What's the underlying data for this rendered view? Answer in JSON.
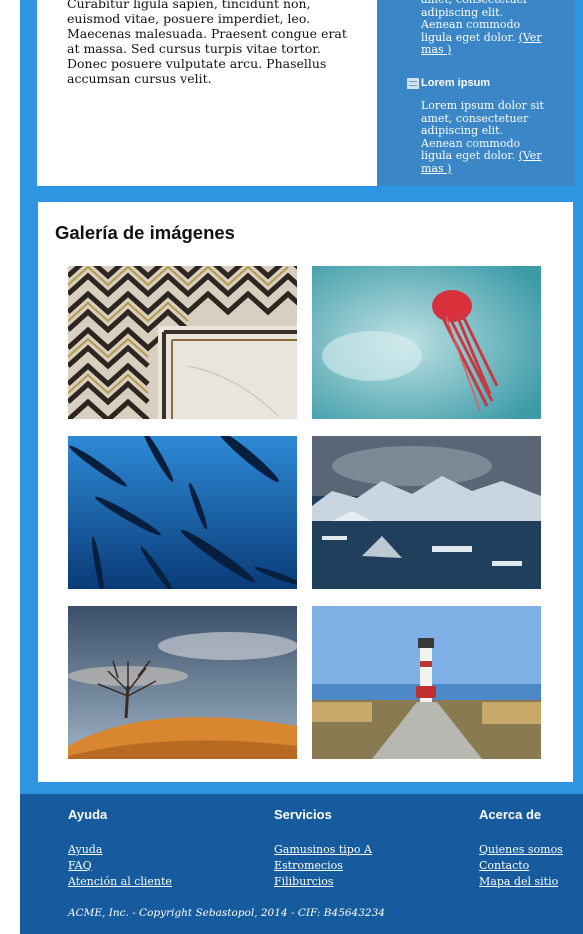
{
  "main": {
    "paragraph_tail": "Curabitur ligula sapien, tincidunt non, euismod vitae, posuere imperdiet, leo. Maecenas malesuada. Praesent congue erat at massa. Sed cursus turpis vitae tortor. Donec posuere vulputate arcu. Phasellus accumsan cursus velit."
  },
  "aside": {
    "item1_text": "amet, consectetuer adipiscing elit. Aenean commodo ligula eget dolor.",
    "item1_link": "(Ver mas )",
    "item2_title": "Lorem ipsum",
    "item2_text": "Lorem ipsum dolor sit amet, consectetuer adipiscing elit. Aenean commodo ligula eget dolor.",
    "item2_link": "(Ver mas )"
  },
  "gallery": {
    "title": "Galería de imágenes",
    "images": [
      {
        "name": "marble-inlay-image"
      },
      {
        "name": "jellyfish-image"
      },
      {
        "name": "fish-school-image"
      },
      {
        "name": "icebergs-image"
      },
      {
        "name": "lone-tree-image"
      },
      {
        "name": "lighthouse-road-image"
      }
    ]
  },
  "footer": {
    "columns": [
      {
        "title": "Ayuda",
        "links": [
          "Ayuda",
          "FAQ",
          "Atención al cliente"
        ]
      },
      {
        "title": "Servicios",
        "links": [
          "Gamusinos tipo A",
          "Estromecios",
          "Filiburcios"
        ]
      },
      {
        "title": "Acerca de",
        "links": [
          "Quienes somos",
          "Contacto",
          "Mapa del sitio"
        ]
      }
    ],
    "copyright": "ACME, Inc. - Copyright Sebastopol, 2014 - CIF: B45643234"
  },
  "colors": {
    "frame_blue": "#2d95e1",
    "aside_blue": "#3b86c6",
    "footer_blue": "#155b9e"
  }
}
